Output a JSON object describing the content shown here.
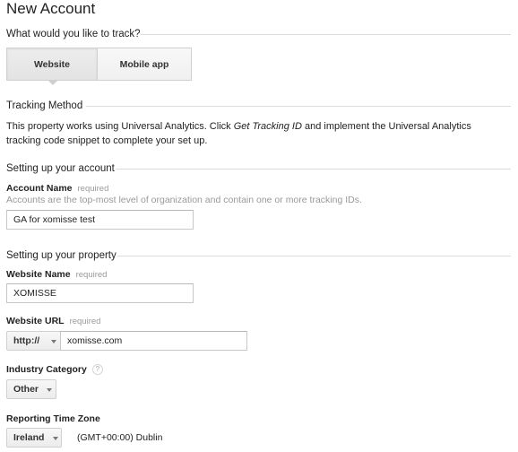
{
  "page": {
    "title": "New Account"
  },
  "track": {
    "heading": "What would you like to track?",
    "tabs": [
      {
        "label": "Website",
        "selected": true
      },
      {
        "label": "Mobile app",
        "selected": false
      }
    ]
  },
  "tracking_method": {
    "heading": "Tracking Method",
    "text_before": "This property works using Universal Analytics. Click ",
    "link_text": "Get Tracking ID",
    "text_after": " and implement the Universal Analytics tracking code snippet to complete your set up."
  },
  "account": {
    "heading": "Setting up your account",
    "name_label": "Account Name",
    "required_label": "required",
    "help": "Accounts are the top-most level of organization and contain one or more tracking IDs.",
    "name_value": "GA for xomisse test"
  },
  "property": {
    "heading": "Setting up your property",
    "website_name_label": "Website Name",
    "website_name_required": "required",
    "website_name_value": "XOMISSE",
    "website_url_label": "Website URL",
    "website_url_required": "required",
    "protocol_value": "http://",
    "url_value": "xomisse.com",
    "industry_label": "Industry Category",
    "help_icon": "?",
    "industry_value": "Other",
    "timezone_label": "Reporting Time Zone",
    "timezone_country": "Ireland",
    "timezone_value": "(GMT+00:00) Dublin"
  }
}
